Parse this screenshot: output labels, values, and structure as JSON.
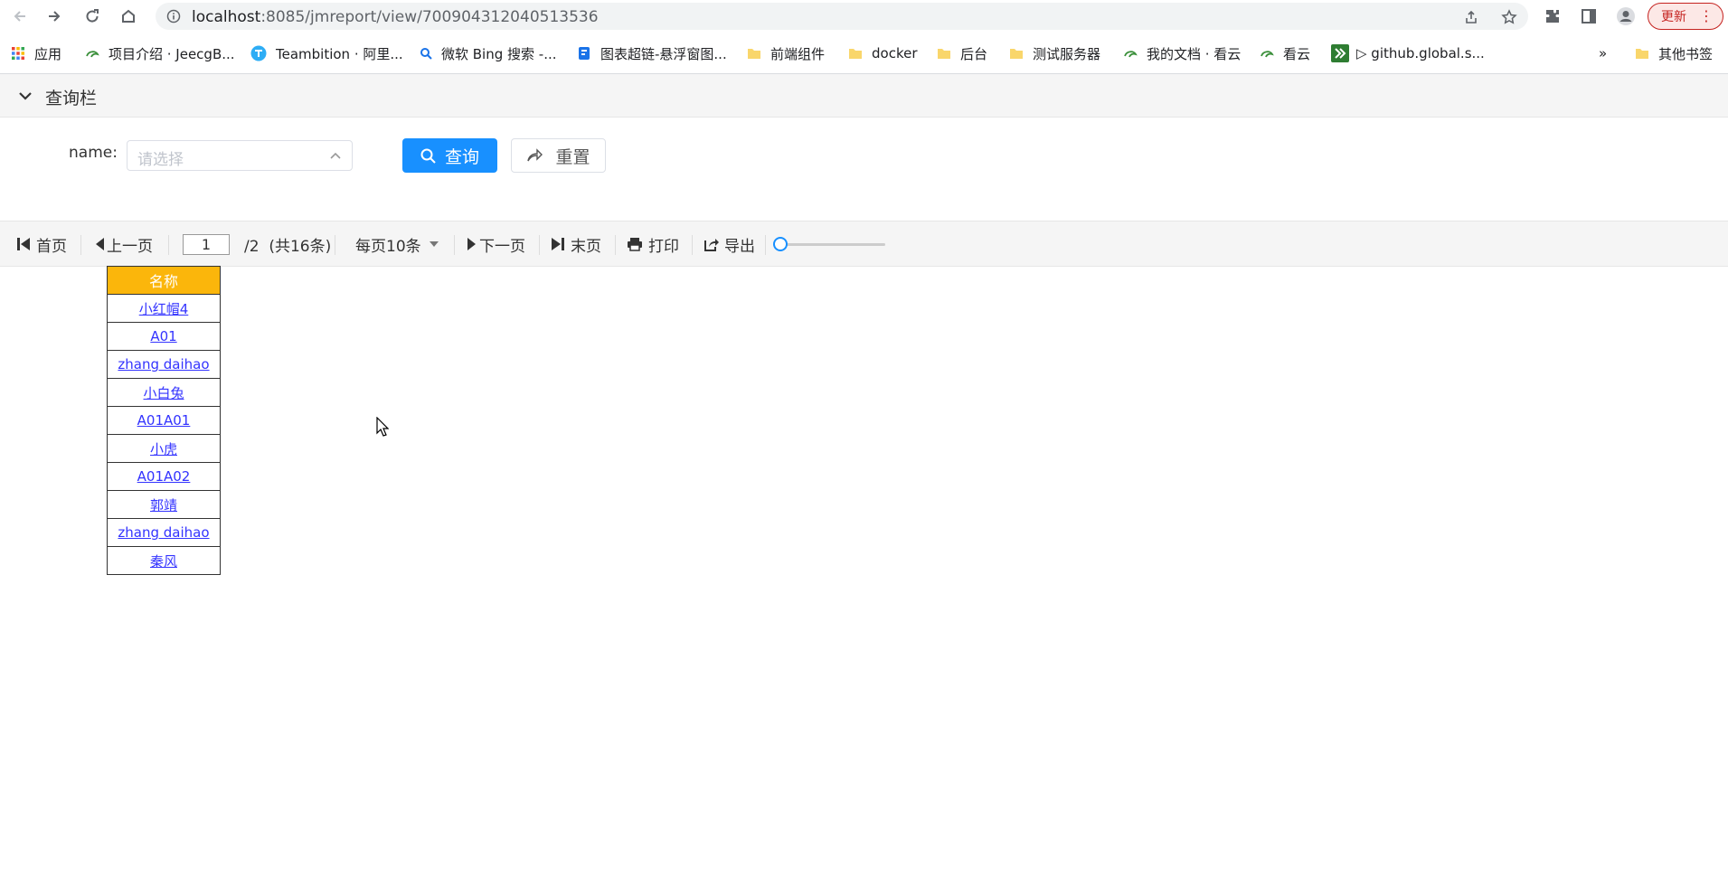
{
  "browser": {
    "url_host": "localhost",
    "url_path": ":8085/jmreport/view/700904312040513536",
    "update_label": "更新",
    "bookmarks": [
      {
        "label": "应用",
        "icon": "apps-grid-icon"
      },
      {
        "label": "项目介绍 · JeecgB...",
        "icon": "kanyun-icon"
      },
      {
        "label": "Teambition · 阿里...",
        "icon": "teambition-icon"
      },
      {
        "label": "微软 Bing 搜索 -...",
        "icon": "search-icon"
      },
      {
        "label": "图表超链-悬浮窗图...",
        "icon": "doc-icon"
      },
      {
        "label": "前端组件",
        "icon": "folder-icon"
      },
      {
        "label": "docker",
        "icon": "folder-icon"
      },
      {
        "label": "后台",
        "icon": "folder-icon"
      },
      {
        "label": "测试服务器",
        "icon": "folder-icon"
      },
      {
        "label": "我的文档 · 看云",
        "icon": "kanyun-icon"
      },
      {
        "label": "看云",
        "icon": "kanyun-icon"
      },
      {
        "label": "▷ github.global.s...",
        "icon": "github-icon"
      },
      {
        "label": "»",
        "icon": "more-icon"
      },
      {
        "label": "其他书签",
        "icon": "folder-icon"
      }
    ],
    "colors": {
      "accent": "#1890ff",
      "header_yellow": "#fbb60b",
      "link": "#3333ff"
    }
  },
  "query": {
    "title": "查询栏",
    "name_label": "name:",
    "select_placeholder": "请选择",
    "query_button": "查询",
    "reset_button": "重置"
  },
  "toolbar": {
    "first": "首页",
    "prev": "上一页",
    "current_page": "1",
    "page_info": "/2  (共16条)",
    "per_page": "每页10条",
    "next": "下一页",
    "last": "末页",
    "print": "打印",
    "export": "导出",
    "zoom_fraction": 0.05
  },
  "table": {
    "header": "名称",
    "rows": [
      "小红帽4",
      "A01",
      "zhang daihao",
      "小白兔",
      "A01A01",
      "小虎",
      "A01A02",
      "郭靖",
      "zhang daihao",
      "秦风"
    ]
  }
}
